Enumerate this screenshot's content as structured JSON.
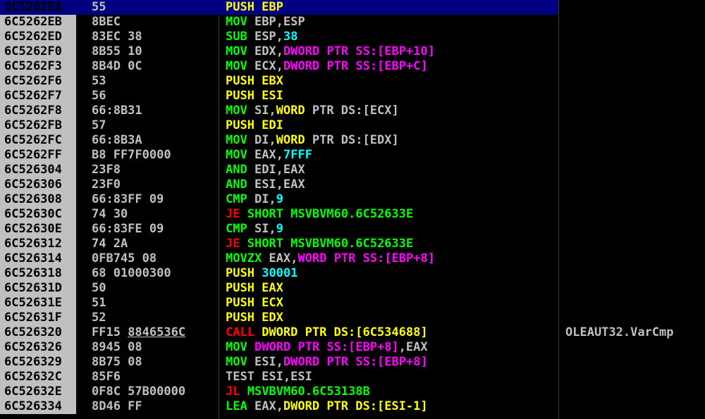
{
  "colors": {
    "address_background": "#c0c0c0",
    "selection_background": "#000080",
    "push_pop": "#ffff00",
    "mov_arith": "#00ff00",
    "jump_call": "#ff0000",
    "size_ptr": "#ff00ff",
    "immediate": "#00ffff",
    "text": "#c0c0c0"
  },
  "rows": [
    {
      "addr": "6C5262EA",
      "hex": "55",
      "selected": true,
      "ins": [
        [
          "PUSH EBP",
          "#ffff00"
        ]
      ]
    },
    {
      "addr": "6C5262EB",
      "hex": "8BEC",
      "ins": [
        [
          "MOV",
          "#00ff00"
        ],
        [
          " EBP,ESP",
          "#c0c0c0"
        ]
      ]
    },
    {
      "addr": "6C5262ED",
      "hex": "83EC 38",
      "ins": [
        [
          "SUB",
          "#00ff00"
        ],
        [
          " ESP,",
          "#c0c0c0"
        ],
        [
          "38",
          "#00ffff"
        ]
      ]
    },
    {
      "addr": "6C5262F0",
      "hex": "8B55 10",
      "ins": [
        [
          "MOV",
          "#00ff00"
        ],
        [
          " EDX,",
          "#c0c0c0"
        ],
        [
          "DWORD PTR SS:[EBP+10]",
          "#ff00ff"
        ]
      ]
    },
    {
      "addr": "6C5262F3",
      "hex": "8B4D 0C",
      "ins": [
        [
          "MOV",
          "#00ff00"
        ],
        [
          " ECX,",
          "#c0c0c0"
        ],
        [
          "DWORD PTR SS:[EBP+C]",
          "#ff00ff"
        ]
      ]
    },
    {
      "addr": "6C5262F6",
      "hex": "53",
      "ins": [
        [
          "PUSH EBX",
          "#ffff00"
        ]
      ]
    },
    {
      "addr": "6C5262F7",
      "hex": "56",
      "ins": [
        [
          "PUSH ESI",
          "#ffff00"
        ]
      ]
    },
    {
      "addr": "6C5262F8",
      "hex": "66:8B31",
      "ins": [
        [
          "MOV",
          "#00ff00"
        ],
        [
          " SI,",
          "#c0c0c0"
        ],
        [
          "WORD",
          "#ffff00"
        ],
        [
          " PTR DS:[ECX]",
          "#c0c0c0"
        ]
      ]
    },
    {
      "addr": "6C5262FB",
      "hex": "57",
      "ins": [
        [
          "PUSH EDI",
          "#ffff00"
        ]
      ]
    },
    {
      "addr": "6C5262FC",
      "hex": "66:8B3A",
      "ins": [
        [
          "MOV",
          "#00ff00"
        ],
        [
          " DI,",
          "#c0c0c0"
        ],
        [
          "WORD",
          "#ffff00"
        ],
        [
          " PTR DS:[EDX]",
          "#c0c0c0"
        ]
      ]
    },
    {
      "addr": "6C5262FF",
      "hex": "B8 FF7F0000",
      "ins": [
        [
          "MOV",
          "#00ff00"
        ],
        [
          " EAX,",
          "#c0c0c0"
        ],
        [
          "7FFF",
          "#00ffff"
        ]
      ]
    },
    {
      "addr": "6C526304",
      "hex": "23F8",
      "ins": [
        [
          "AND",
          "#00ff00"
        ],
        [
          " EDI,EAX",
          "#c0c0c0"
        ]
      ]
    },
    {
      "addr": "6C526306",
      "hex": "23F0",
      "ins": [
        [
          "AND",
          "#00ff00"
        ],
        [
          " ESI,EAX",
          "#c0c0c0"
        ]
      ]
    },
    {
      "addr": "6C526308",
      "hex": "66:83FF 09",
      "ins": [
        [
          "CMP",
          "#00ff00"
        ],
        [
          " DI,",
          "#c0c0c0"
        ],
        [
          "9",
          "#00ffff"
        ]
      ]
    },
    {
      "addr": "6C52630C",
      "hex": "74 30",
      "ins": [
        [
          "JE",
          "#ff0000"
        ],
        [
          " SHORT MSVBVM60.6C52633E",
          "#00ff00"
        ]
      ]
    },
    {
      "addr": "6C52630E",
      "hex": "66:83FE 09",
      "ins": [
        [
          "CMP",
          "#00ff00"
        ],
        [
          " SI,",
          "#c0c0c0"
        ],
        [
          "9",
          "#00ffff"
        ]
      ]
    },
    {
      "addr": "6C526312",
      "hex": "74 2A",
      "ins": [
        [
          "JE",
          "#ff0000"
        ],
        [
          " SHORT MSVBVM60.6C52633E",
          "#00ff00"
        ]
      ]
    },
    {
      "addr": "6C526314",
      "hex": "0FB745 08",
      "ins": [
        [
          "MOVZX",
          "#00ff00"
        ],
        [
          " EAX,",
          "#c0c0c0"
        ],
        [
          "WORD PTR SS:[EBP+8]",
          "#ff00ff"
        ]
      ]
    },
    {
      "addr": "6C526318",
      "hex": "68 01000300",
      "ins": [
        [
          "PUSH",
          "#ffff00"
        ],
        [
          " ",
          "#c0c0c0"
        ],
        [
          "30001",
          "#00ffff"
        ]
      ]
    },
    {
      "addr": "6C52631D",
      "hex": "50",
      "ins": [
        [
          "PUSH EAX",
          "#ffff00"
        ]
      ]
    },
    {
      "addr": "6C52631E",
      "hex": "51",
      "ins": [
        [
          "PUSH ECX",
          "#ffff00"
        ]
      ]
    },
    {
      "addr": "6C52631F",
      "hex": "52",
      "ins": [
        [
          "PUSH EDX",
          "#ffff00"
        ]
      ]
    },
    {
      "addr": "6C526320",
      "hex": "FF15 ",
      "hex_link": "8846536C",
      "ins": [
        [
          "CALL",
          "#ff0000"
        ],
        [
          " DWORD PTR DS:[6C534688]",
          "#ffff00"
        ]
      ],
      "comment": "OLEAUT32.VarCmp"
    },
    {
      "addr": "6C526326",
      "hex": "8945 08",
      "ins": [
        [
          "MOV",
          "#00ff00"
        ],
        [
          " ",
          "#c0c0c0"
        ],
        [
          "DWORD PTR SS:[EBP+8]",
          "#ff00ff"
        ],
        [
          ",EAX",
          "#c0c0c0"
        ]
      ]
    },
    {
      "addr": "6C526329",
      "hex": "8B75 08",
      "ins": [
        [
          "MOV",
          "#00ff00"
        ],
        [
          " ESI,",
          "#c0c0c0"
        ],
        [
          "DWORD PTR SS:[EBP+8]",
          "#ff00ff"
        ]
      ]
    },
    {
      "addr": "6C52632C",
      "hex": "85F6",
      "ins": [
        [
          "TEST ESI,ESI",
          "#c0c0c0"
        ]
      ]
    },
    {
      "addr": "6C52632E",
      "hex": "0F8C 57B00000",
      "ins": [
        [
          "JL",
          "#ff0000"
        ],
        [
          " MSVBVM60.6C53138B",
          "#00ff00"
        ]
      ]
    },
    {
      "addr": "6C526334",
      "hex": "8D46 FF",
      "ins": [
        [
          "LEA",
          "#00ff00"
        ],
        [
          " EAX,",
          "#c0c0c0"
        ],
        [
          "DWORD PTR DS:[ESI-1]",
          "#ffff00"
        ]
      ]
    }
  ]
}
